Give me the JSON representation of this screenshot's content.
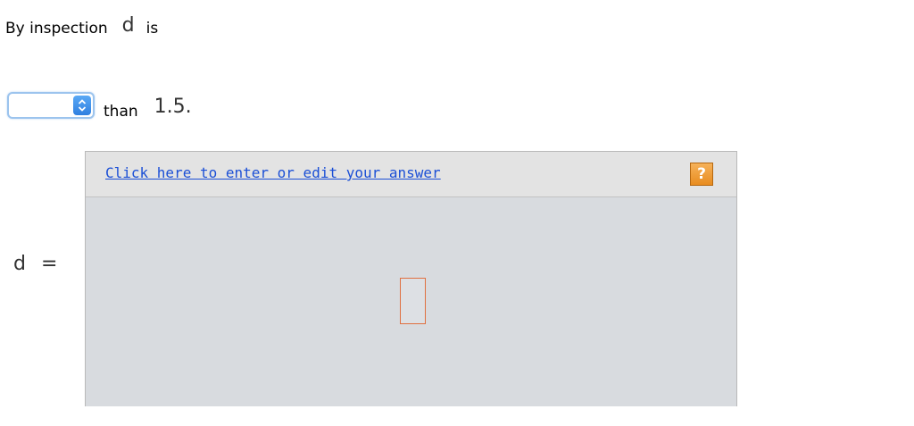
{
  "question": {
    "line1_prefix": "By inspection",
    "variable": "d",
    "line1_suffix": "is",
    "comparison_select": {
      "selected_value": "",
      "icon": "select-updown-arrows-icon"
    },
    "line2_text": "than",
    "threshold": "1.5."
  },
  "answer": {
    "variable": "d",
    "equals": "=",
    "link_text": "Click here to enter or edit your answer",
    "help_label": "?",
    "help_icon": "help-question-icon"
  },
  "colors": {
    "link": "#1b4fd6",
    "help_icon": "#e88c1f",
    "answer_area": "#d8dbdf",
    "select_accent": "#2f7fe0",
    "slot_border": "#e07040"
  }
}
